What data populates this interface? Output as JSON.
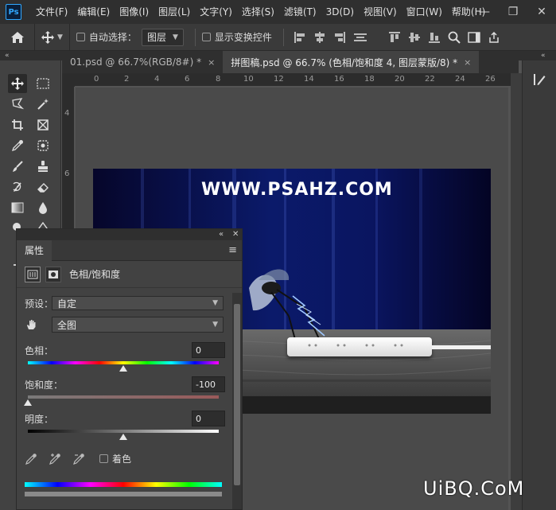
{
  "menubar": {
    "logo": "Ps",
    "items": [
      "文件(F)",
      "编辑(E)",
      "图像(I)",
      "图层(L)",
      "文字(Y)",
      "选择(S)",
      "滤镜(T)",
      "3D(D)",
      "视图(V)",
      "窗口(W)",
      "帮助(H)"
    ],
    "minimize": "—",
    "restore": "❐",
    "close": "✕"
  },
  "options": {
    "auto_select_label": "自动选择：",
    "auto_select_value": "图层",
    "transform_label": "显示变换控件"
  },
  "strips": {
    "left": "«",
    "right": "«"
  },
  "tabs": [
    {
      "label": "01.psd @ 66.7%(RGB/8#) *",
      "close": "×"
    },
    {
      "label": "拼图稿.psd @ 66.7% (色相/饱和度 4, 图层蒙版/8) *",
      "close": "×"
    }
  ],
  "ruler_h": [
    "0",
    "2",
    "4",
    "6",
    "8",
    "10",
    "12",
    "14",
    "16",
    "18",
    "20",
    "22",
    "24",
    "26"
  ],
  "ruler_v": [
    "4",
    "6"
  ],
  "document": {
    "title": "WWW.PSAHZ.COM"
  },
  "properties": {
    "collapse": "«",
    "close": "✕",
    "tab_label": "属性",
    "menu": "≡",
    "type_label": "色相/饱和度",
    "preset_label": "预设：",
    "preset_value": "自定",
    "channel_value": "全图",
    "hue_label": "色相：",
    "hue_value": "0",
    "saturation_label": "饱和度：",
    "saturation_value": "-100",
    "lightness_label": "明度：",
    "lightness_value": "0",
    "colorize_label": "着色"
  },
  "watermark": "UiBQ.CoM",
  "colors": {
    "accent": "#31a8ff",
    "canvas_bg": "#4a4a4a",
    "panel_bg": "#424242"
  }
}
